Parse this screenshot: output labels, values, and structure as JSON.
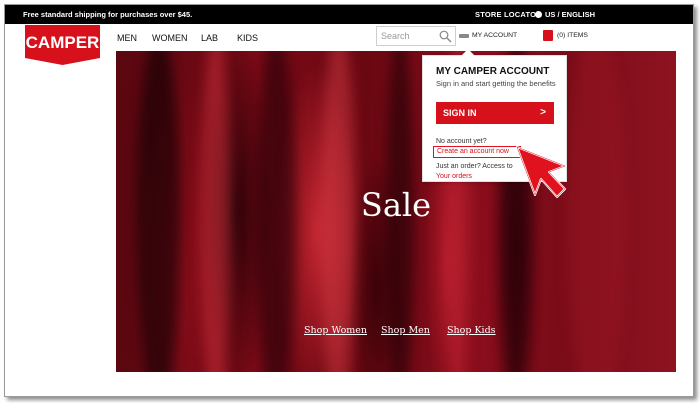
{
  "topbar": {
    "promo": "Free standard shipping for purchases over $45.",
    "store_locator": "STORE LOCATOR",
    "language": "US / ENGLISH"
  },
  "header": {
    "logo_text": "CAMPER",
    "nav": [
      "MEN",
      "WOMEN",
      "LAB",
      "KIDS"
    ],
    "search_placeholder": "Search",
    "account_label": "MY ACCOUNT",
    "items_label": "(0) ITEMS"
  },
  "hero": {
    "title": "Sale",
    "links": [
      "Shop Women",
      "Shop Men",
      "Shop Kids"
    ]
  },
  "account_dropdown": {
    "title": "MY CAMPER ACCOUNT",
    "subtitle": "Sign in and start getting the benefits",
    "sign_in_label": "SIGN IN",
    "sign_in_arrow": ">",
    "no_account_text": "No account yet?",
    "create_account_link": "Create an account now",
    "order_text": "Just an order? Access to",
    "your_orders_link": "Your orders"
  },
  "colors": {
    "brand_red": "#d7111b",
    "topbar_bg": "#000000",
    "hero_red": "#7a0a16"
  },
  "icons": [
    "search-icon",
    "user-icon",
    "bag-icon",
    "globe-icon",
    "pointer-arrow-icon"
  ]
}
